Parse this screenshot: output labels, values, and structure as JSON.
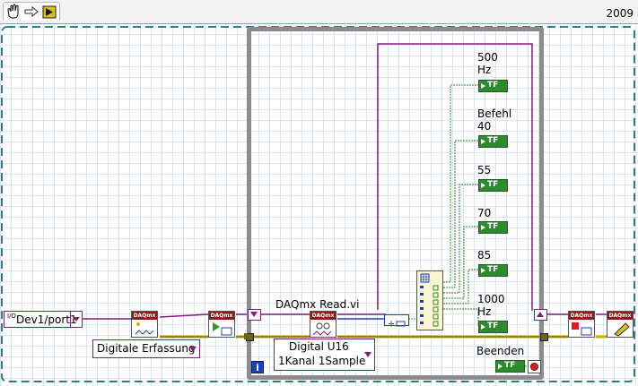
{
  "toolbar": {
    "icons": [
      "hand-icon",
      "step-arrow-icon",
      "run-icon"
    ],
    "version_label": "2009"
  },
  "channel_control": {
    "icon": "io-icon",
    "io_glyph": "I/O",
    "value": "Dev1/port1"
  },
  "task_type_ring": {
    "value": "Digitale Erfassung"
  },
  "read_vi_label": "DAQmx Read.vi",
  "read_mode_ring": {
    "line1": "Digital U16",
    "line2": "1Kanal 1Sample"
  },
  "indicators": [
    {
      "line1": "500",
      "line2": "Hz",
      "badge": "TF"
    },
    {
      "line1": "Befehl",
      "line2": "40",
      "badge": "TF"
    },
    {
      "line1": "55",
      "line2": "",
      "badge": "TF"
    },
    {
      "line1": "70",
      "line2": "",
      "badge": "TF"
    },
    {
      "line1": "85",
      "line2": "",
      "badge": "TF"
    },
    {
      "line1": "1000",
      "line2": "Hz",
      "badge": "TF"
    }
  ],
  "stop_control": {
    "label": "Beenden",
    "badge": "TF"
  },
  "loop_iteration_label": "i",
  "daqmx_header": "DAQmx",
  "colors": {
    "wire_daq": "#7d1f7d",
    "wire_error": "#c8b400",
    "wire_bool": "#2f8a2f",
    "loop_frame": "#8c8c8c",
    "grid": "#dfe3ea"
  }
}
